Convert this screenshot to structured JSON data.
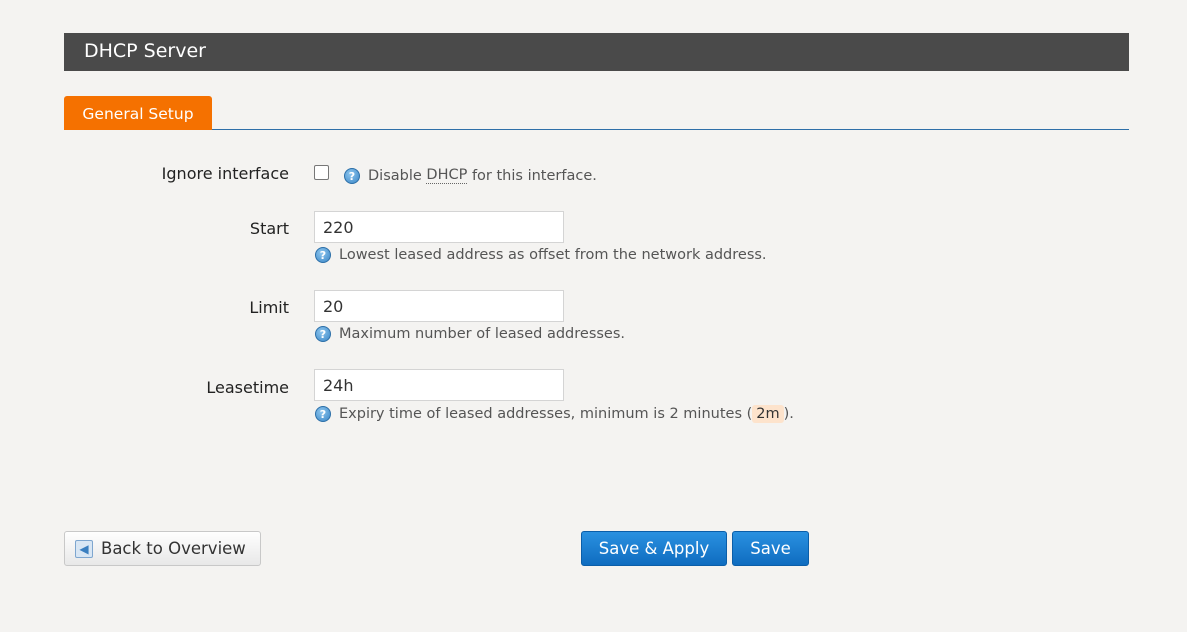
{
  "section": {
    "title": "DHCP Server"
  },
  "tabs": [
    {
      "label": "General Setup",
      "active": true
    }
  ],
  "fields": {
    "ignore_interface": {
      "label": "Ignore interface",
      "checked": false,
      "help_before": "Disable ",
      "help_abbr": "DHCP",
      "help_after": " for this interface."
    },
    "start": {
      "label": "Start",
      "value": "220",
      "help": "Lowest leased address as offset from the network address."
    },
    "limit": {
      "label": "Limit",
      "value": "20",
      "help": "Maximum number of leased addresses."
    },
    "leasetime": {
      "label": "Leasetime",
      "value": "24h",
      "help_before": "Expiry time of leased addresses, minimum is 2 minutes (",
      "help_code": "2m",
      "help_after": ")."
    }
  },
  "buttons": {
    "back": "Back to Overview",
    "save_apply": "Save & Apply",
    "save": "Save"
  },
  "colors": {
    "tab_active": "#f57100",
    "primary_button": "#1a7fd4",
    "section_bar": "#4a4a4a"
  },
  "icons": {
    "help": "info-icon",
    "back": "back-arrow-icon"
  }
}
